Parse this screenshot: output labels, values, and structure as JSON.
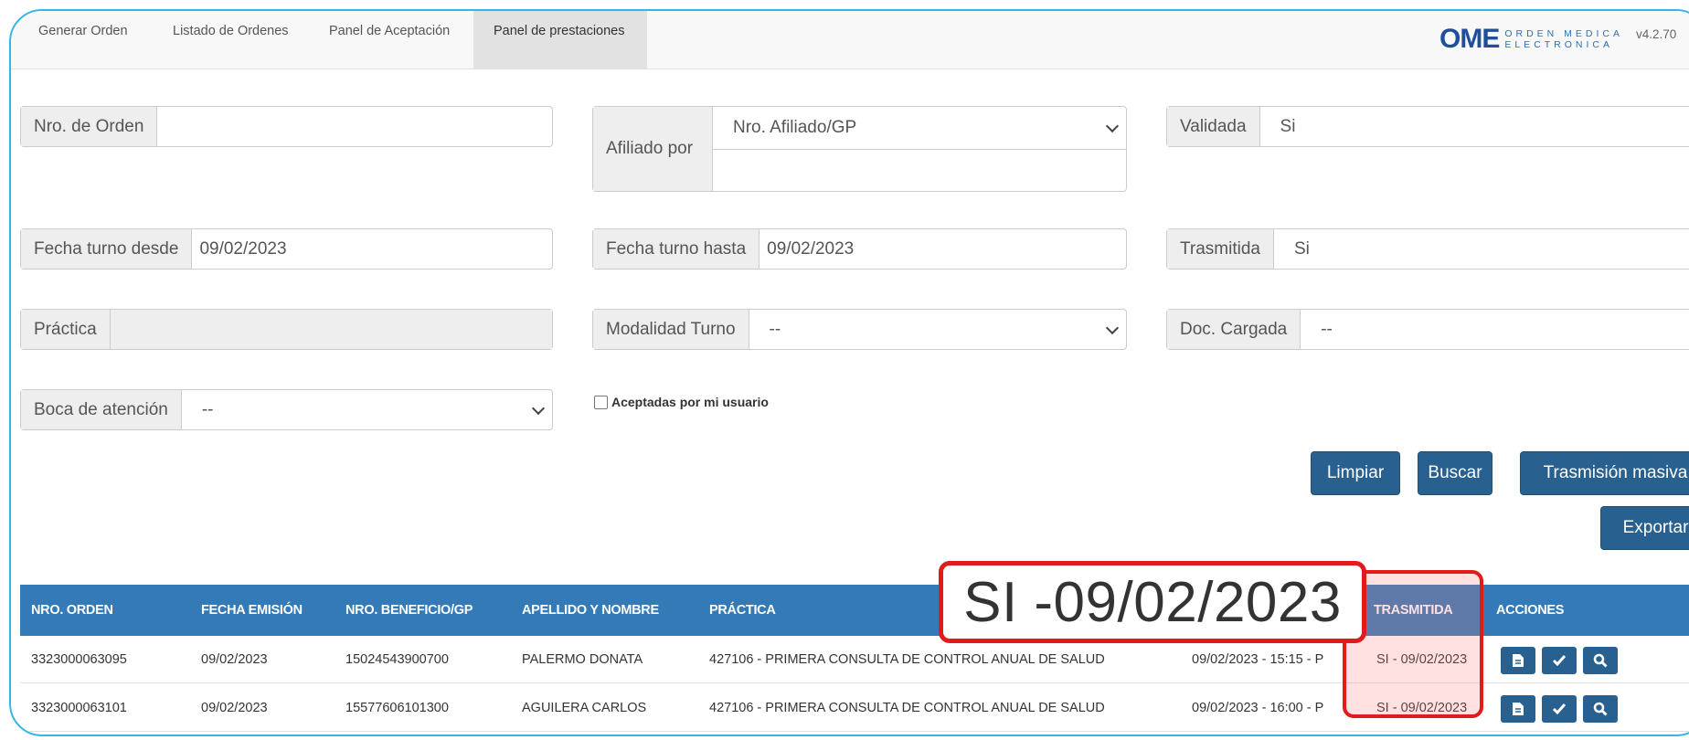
{
  "nav": {
    "tabs": [
      "Generar Orden",
      "Listado de Ordenes",
      "Panel de Aceptación",
      "Panel de prestaciones"
    ],
    "active_tab": "Panel de prestaciones",
    "brand": {
      "logo": "OME",
      "line1": "ORDEN MEDICA",
      "line2": "ELECTRONICA"
    },
    "version": "v4.2.70"
  },
  "filters": {
    "nro_orden": {
      "label": "Nro. de Orden",
      "value": ""
    },
    "afiliado": {
      "label": "Afiliado por",
      "select_value": "Nro. Afiliado/GP",
      "text_value": ""
    },
    "validada": {
      "label": "Validada",
      "value": "Si"
    },
    "fecha_desde": {
      "label": "Fecha turno desde",
      "value": "09/02/2023"
    },
    "fecha_hasta": {
      "label": "Fecha turno hasta",
      "value": "09/02/2023"
    },
    "trasmitida": {
      "label": "Trasmitida",
      "value": "Si"
    },
    "practica": {
      "label": "Práctica",
      "value": ""
    },
    "modalidad": {
      "label": "Modalidad Turno",
      "value": "--"
    },
    "doc_cargada": {
      "label": "Doc. Cargada",
      "value": "--"
    },
    "boca": {
      "label": "Boca de atención",
      "value": "--"
    },
    "aceptadas_label": "Aceptadas por mi usuario"
  },
  "buttons": {
    "limpiar": "Limpiar",
    "buscar": "Buscar",
    "trasmision_masiva": "Trasmisión masiva",
    "exportar": "Exportar"
  },
  "table": {
    "headers": [
      "NRO. ORDEN",
      "FECHA EMISIÓN",
      "NRO. BENEFICIO/GP",
      "APELLIDO Y NOMBRE",
      "PRÁCTICA",
      "TRASMITIDA",
      "ACCIONES"
    ],
    "rows": [
      {
        "nro_orden": "3323000063095",
        "fecha_emision": "09/02/2023",
        "beneficio": "15024543900700",
        "nombre": "PALERMO DONATA",
        "practica": "427106 - PRIMERA CONSULTA DE CONTROL ANUAL DE SALUD",
        "turno": "09/02/2023 - 15:15 - P",
        "trasmitida": "SI - 09/02/2023"
      },
      {
        "nro_orden": "3323000063101",
        "fecha_emision": "09/02/2023",
        "beneficio": "15577606101300",
        "nombre": "AGUILERA CARLOS",
        "practica": "427106 - PRIMERA CONSULTA DE CONTROL ANUAL DE SALUD",
        "turno": "09/02/2023 - 16:00 - P",
        "trasmitida": "SI - 09/02/2023"
      }
    ]
  },
  "callout": "SI -09/02/2023",
  "colors": {
    "primary": "#286090",
    "header": "#337ab7",
    "highlight": "#e01b1b",
    "frame": "#37b6e3"
  }
}
